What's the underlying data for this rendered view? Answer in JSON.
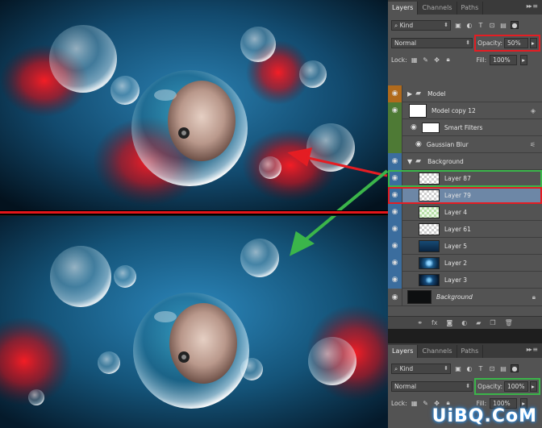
{
  "watermark": "UiBQ.CoM",
  "panel_top": {
    "tabs": [
      "Layers",
      "Channels",
      "Paths"
    ],
    "tab_menu": "▸▸ ≡",
    "kind_label": "Kind",
    "blend_mode": "Normal",
    "opacity_label": "Opacity:",
    "opacity_value": "50%",
    "lock_label": "Lock:",
    "fill_label": "Fill:",
    "fill_value": "100%",
    "layers": [
      {
        "name": "Model",
        "kind": "group",
        "vis": "orange",
        "expanded": false
      },
      {
        "name": "Model copy 12",
        "kind": "smart",
        "vis": "green"
      },
      {
        "name": "Smart Filters",
        "kind": "filter-header",
        "vis": "green"
      },
      {
        "name": "Gaussian Blur",
        "kind": "filter",
        "vis": "green"
      },
      {
        "name": "Background",
        "kind": "group",
        "vis": "blue",
        "expanded": true
      },
      {
        "name": "Layer 87",
        "kind": "layer",
        "thumb": "trans",
        "vis": "blue",
        "highlight": "green"
      },
      {
        "name": "Layer 79",
        "kind": "layer",
        "thumb": "trans",
        "vis": "blue",
        "highlight": "red",
        "selected": true
      },
      {
        "name": "Layer 4",
        "kind": "layer",
        "thumb": "green",
        "vis": "blue"
      },
      {
        "name": "Layer 61",
        "kind": "layer",
        "thumb": "trans",
        "vis": "blue"
      },
      {
        "name": "Layer 5",
        "kind": "layer",
        "thumb": "blue1",
        "vis": "blue"
      },
      {
        "name": "Layer 2",
        "kind": "layer",
        "thumb": "blue2",
        "vis": "blue"
      },
      {
        "name": "Layer 3",
        "kind": "layer",
        "thumb": "blue3",
        "vis": "blue"
      },
      {
        "name": "Background",
        "kind": "background",
        "thumb": "black",
        "vis": "none"
      }
    ]
  },
  "panel_bottom": {
    "tabs": [
      "Layers",
      "Channels",
      "Paths"
    ],
    "kind_label": "Kind",
    "blend_mode": "Normal",
    "opacity_label": "Opacity:",
    "opacity_value": "100%",
    "lock_label": "Lock:",
    "fill_label": "Fill:",
    "fill_value": "100%"
  },
  "colors": {
    "highlight_red": "#e41d23",
    "highlight_green": "#3bb54a",
    "selected_row": "#6d87a6"
  }
}
